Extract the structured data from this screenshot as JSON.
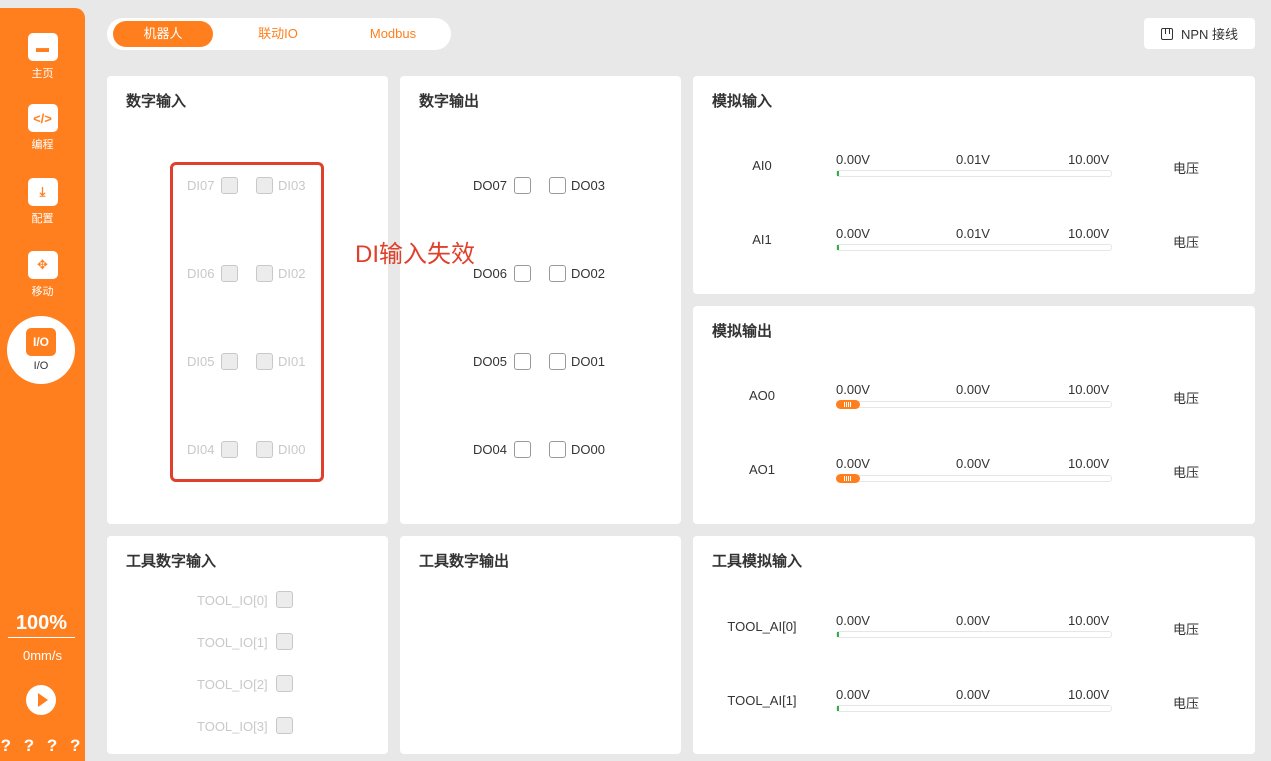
{
  "sidebar": {
    "items": [
      {
        "label": "主页",
        "icon": "home-icon",
        "glyph": "▬"
      },
      {
        "label": "编程",
        "icon": "code-icon",
        "glyph": "</>"
      },
      {
        "label": "配置",
        "icon": "config-icon",
        "glyph": "⤓"
      },
      {
        "label": "移动",
        "icon": "move-icon",
        "glyph": "✥"
      },
      {
        "label": "I/O",
        "icon": "io-icon",
        "glyph": "I/O"
      }
    ],
    "speed_percent": "100%",
    "speed_mm": "0mm/s",
    "question_marks": "? ? ? ?"
  },
  "tabs": [
    {
      "label": "机器人",
      "active": true
    },
    {
      "label": "联动IO",
      "active": false
    },
    {
      "label": "Modbus",
      "active": false
    }
  ],
  "npn_button": "NPN 接线",
  "digital_input": {
    "title": "数字输入",
    "left": [
      "DI07",
      "DI06",
      "DI05",
      "DI04"
    ],
    "right": [
      "DI03",
      "DI02",
      "DI01",
      "DI00"
    ]
  },
  "annotation": "DI输入失效",
  "digital_output": {
    "title": "数字输出",
    "left": [
      "DO07",
      "DO06",
      "DO05",
      "DO04"
    ],
    "right": [
      "DO03",
      "DO02",
      "DO01",
      "DO00"
    ]
  },
  "analog_input": {
    "title": "模拟输入",
    "rows": [
      {
        "name": "AI0",
        "min": "0.00V",
        "current": "0.01V",
        "max": "10.00V",
        "unit": "电压"
      },
      {
        "name": "AI1",
        "min": "0.00V",
        "current": "0.01V",
        "max": "10.00V",
        "unit": "电压"
      }
    ]
  },
  "analog_output": {
    "title": "模拟输出",
    "rows": [
      {
        "name": "AO0",
        "min": "0.00V",
        "current": "0.00V",
        "max": "10.00V",
        "unit": "电压"
      },
      {
        "name": "AO1",
        "min": "0.00V",
        "current": "0.00V",
        "max": "10.00V",
        "unit": "电压"
      }
    ]
  },
  "tool_digital_input": {
    "title": "工具数字输入",
    "items": [
      "TOOL_IO[0]",
      "TOOL_IO[1]",
      "TOOL_IO[2]",
      "TOOL_IO[3]"
    ]
  },
  "tool_digital_output": {
    "title": "工具数字输出"
  },
  "tool_analog_input": {
    "title": "工具模拟输入",
    "rows": [
      {
        "name": "TOOL_AI[0]",
        "min": "0.00V",
        "current": "0.00V",
        "max": "10.00V",
        "unit": "电压"
      },
      {
        "name": "TOOL_AI[1]",
        "min": "0.00V",
        "current": "0.00V",
        "max": "10.00V",
        "unit": "电压"
      }
    ]
  },
  "colors": {
    "accent": "#ff7f1e",
    "annotation": "#e0402b",
    "level": "#2db24a"
  }
}
